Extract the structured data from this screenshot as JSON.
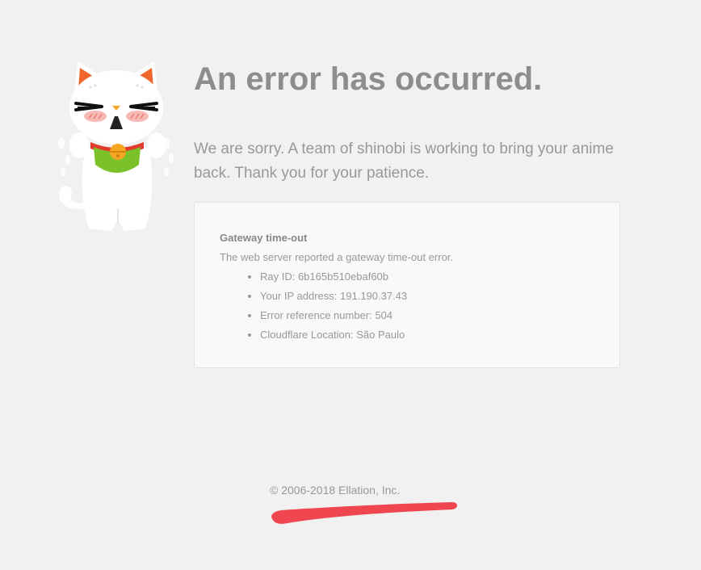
{
  "header": {
    "title": "An error has occurred.",
    "apology": "We are sorry. A team of shinobi is working to bring your anime back. Thank you for your patience."
  },
  "error": {
    "heading": "Gateway time-out",
    "description": "The web server reported a gateway time-out error.",
    "details": [
      "Ray ID: 6b165b510ebaf60b",
      "Your IP address: 191.190.37.43",
      "Error reference number: 504",
      "Cloudflare Location: São Paulo"
    ]
  },
  "footer": {
    "copyright": "© 2006-2018 Ellation, Inc."
  },
  "colors": {
    "background": "#f2f1f1",
    "accent_orange": "#f0662c",
    "bib_green": "#7ac12a",
    "bell_gold": "#f5a623",
    "annotation_red": "#f0464f"
  },
  "icons": {
    "mascot": "maneki-neko-cat-mascot"
  }
}
